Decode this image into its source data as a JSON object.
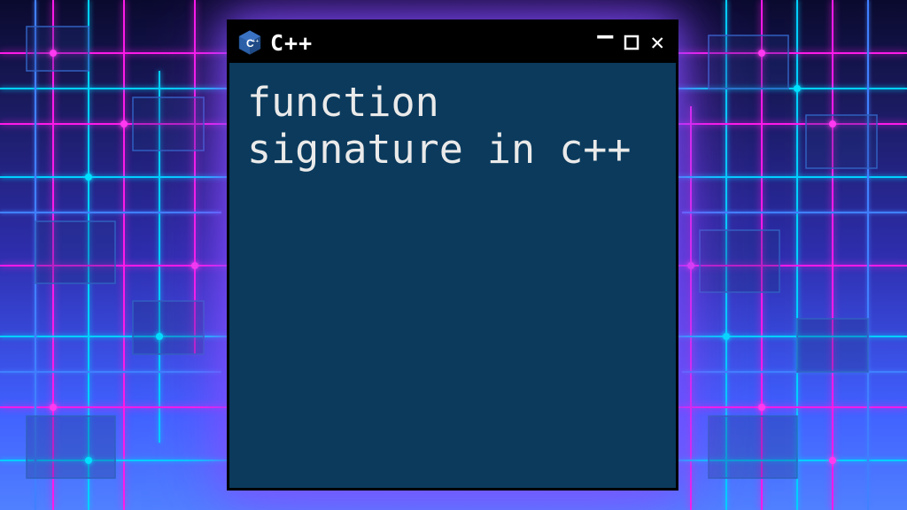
{
  "window": {
    "icon_label": "C++",
    "title": "C++",
    "content": "function signature in c++"
  },
  "controls": {
    "minimize_glyph": "—",
    "close_glyph": "✕"
  },
  "colors": {
    "bg_window": "#0b3a5c",
    "titlebar": "#000000",
    "text": "#eaeaea",
    "neon_magenta": "#ff1ae8",
    "neon_cyan": "#00d0ff",
    "cpp_blue": "#2b5fa8"
  }
}
